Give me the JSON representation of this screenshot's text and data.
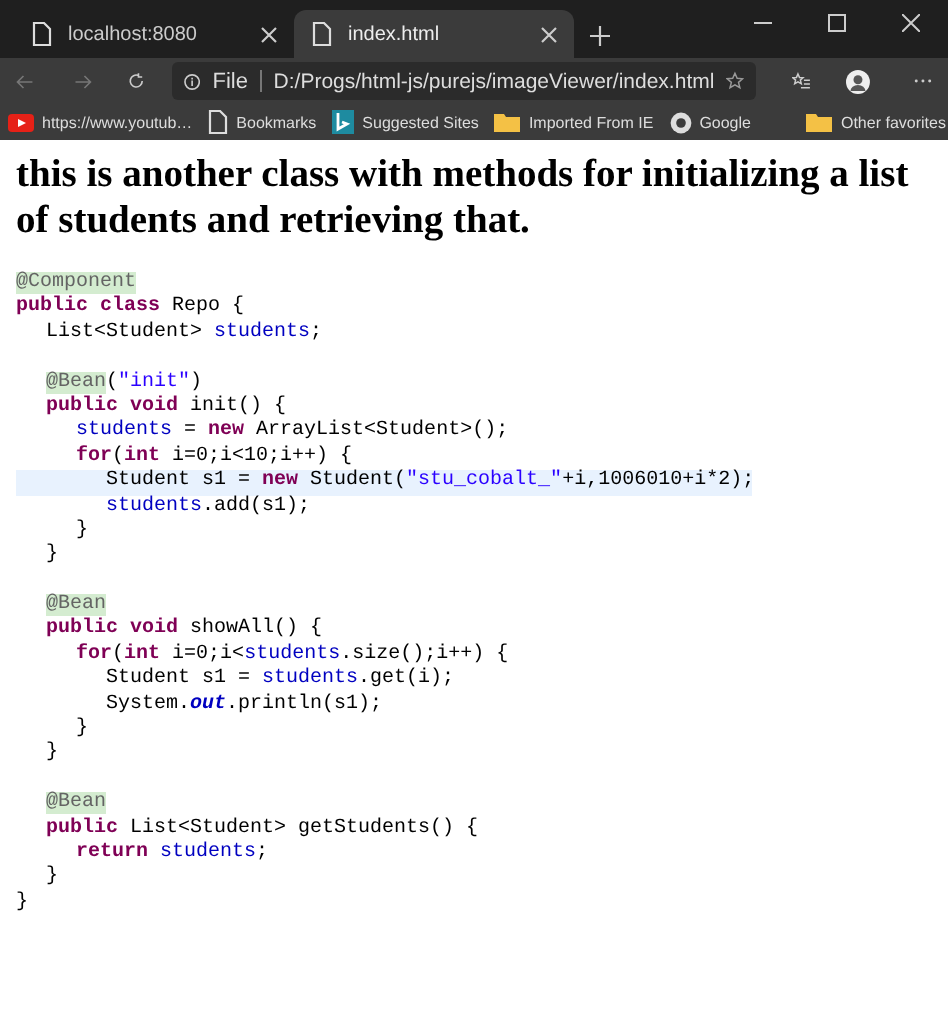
{
  "tabs": [
    {
      "title": "localhost:8080",
      "selected": false
    },
    {
      "title": "index.html",
      "selected": true
    }
  ],
  "address_bar": {
    "scheme": "File",
    "url": "D:/Progs/html-js/purejs/imageViewer/index.html"
  },
  "bookmarks": [
    {
      "label": "https://www.youtub…",
      "kind": "video"
    },
    {
      "label": "Bookmarks",
      "kind": "page"
    },
    {
      "label": "Suggested Sites",
      "kind": "search"
    },
    {
      "label": "Imported From IE",
      "kind": "folder"
    },
    {
      "label": "Google",
      "kind": "globe"
    }
  ],
  "other_bookmarks": {
    "label": "Other favorites",
    "kind": "folder"
  },
  "page": {
    "heading": "this is another class with methods for initializing a list of students and retrieving that.",
    "code": [
      {
        "kind": "code",
        "current": false,
        "segs": [
          {
            "kind": "ann",
            "t": "@Component"
          }
        ]
      },
      {
        "kind": "code",
        "current": false,
        "segs": [
          {
            "kind": "kw",
            "t": "public class"
          },
          {
            "kind": "p",
            "t": " Repo {"
          }
        ],
        "children": [
          {
            "kind": "code",
            "current": false,
            "segs": [
              {
                "kind": "p",
                "t": "List<Student> "
              },
              {
                "kind": "f",
                "t": "students"
              },
              {
                "kind": "p",
                "t": ";"
              }
            ]
          },
          {
            "kind": "blank"
          },
          {
            "kind": "code",
            "current": false,
            "segs": [
              {
                "kind": "ann",
                "t": "@Bean"
              },
              {
                "kind": "p",
                "t": "("
              },
              {
                "kind": "s",
                "t": "\"init\""
              },
              {
                "kind": "p",
                "t": ")"
              }
            ]
          },
          {
            "kind": "code",
            "current": false,
            "segs": [
              {
                "kind": "kw",
                "t": "public void"
              },
              {
                "kind": "p",
                "t": " init() {"
              }
            ],
            "children": [
              {
                "kind": "code",
                "current": false,
                "segs": [
                  {
                    "kind": "f",
                    "t": "students"
                  },
                  {
                    "kind": "p",
                    "t": " = "
                  },
                  {
                    "kind": "kw",
                    "t": "new"
                  },
                  {
                    "kind": "p",
                    "t": " ArrayList<Student>();"
                  }
                ]
              },
              {
                "kind": "code",
                "current": false,
                "segs": [
                  {
                    "kind": "kw",
                    "t": "for"
                  },
                  {
                    "kind": "p",
                    "t": "("
                  },
                  {
                    "kind": "kw",
                    "t": "int"
                  },
                  {
                    "kind": "p",
                    "t": " i=0;i<10;i++) {"
                  }
                ],
                "children": [
                  {
                    "kind": "code",
                    "current": true,
                    "segs": [
                      {
                        "kind": "p",
                        "t": "Student s1 = "
                      },
                      {
                        "kind": "kw",
                        "t": "new"
                      },
                      {
                        "kind": "p",
                        "t": " Student("
                      },
                      {
                        "kind": "s",
                        "t": "\"stu_cobalt_\""
                      },
                      {
                        "kind": "p",
                        "t": "+i,1006010+i*2);"
                      }
                    ]
                  },
                  {
                    "kind": "code",
                    "current": false,
                    "segs": [
                      {
                        "kind": "f",
                        "t": "students"
                      },
                      {
                        "kind": "p",
                        "t": ".add(s1);"
                      }
                    ]
                  }
                ]
              },
              {
                "kind": "code",
                "current": false,
                "segs": [
                  {
                    "kind": "p",
                    "t": "}"
                  }
                ]
              }
            ]
          },
          {
            "kind": "code",
            "current": false,
            "segs": [
              {
                "kind": "p",
                "t": "}"
              }
            ]
          },
          {
            "kind": "blank"
          },
          {
            "kind": "code",
            "current": false,
            "segs": [
              {
                "kind": "ann",
                "t": "@Bean"
              }
            ]
          },
          {
            "kind": "code",
            "current": false,
            "segs": [
              {
                "kind": "kw",
                "t": "public void"
              },
              {
                "kind": "p",
                "t": " showAll() {"
              }
            ],
            "children": [
              {
                "kind": "code",
                "current": false,
                "segs": [
                  {
                    "kind": "kw",
                    "t": "for"
                  },
                  {
                    "kind": "p",
                    "t": "("
                  },
                  {
                    "kind": "kw",
                    "t": "int"
                  },
                  {
                    "kind": "p",
                    "t": " i=0;i<"
                  },
                  {
                    "kind": "f",
                    "t": "students"
                  },
                  {
                    "kind": "p",
                    "t": ".size();i++) {"
                  }
                ],
                "children": [
                  {
                    "kind": "code",
                    "current": false,
                    "segs": [
                      {
                        "kind": "p",
                        "t": "Student s1 = "
                      },
                      {
                        "kind": "f",
                        "t": "students"
                      },
                      {
                        "kind": "p",
                        "t": ".get(i);"
                      }
                    ]
                  },
                  {
                    "kind": "code",
                    "current": false,
                    "segs": [
                      {
                        "kind": "p",
                        "t": "System."
                      },
                      {
                        "kind": "sf",
                        "t": "out"
                      },
                      {
                        "kind": "p",
                        "t": ".println(s1);"
                      }
                    ]
                  }
                ]
              },
              {
                "kind": "code",
                "current": false,
                "segs": [
                  {
                    "kind": "p",
                    "t": "}"
                  }
                ]
              }
            ]
          },
          {
            "kind": "code",
            "current": false,
            "segs": [
              {
                "kind": "p",
                "t": "}"
              }
            ]
          },
          {
            "kind": "blank"
          },
          {
            "kind": "code",
            "current": false,
            "segs": [
              {
                "kind": "ann",
                "t": "@Bean"
              }
            ]
          },
          {
            "kind": "code",
            "current": false,
            "segs": [
              {
                "kind": "kw",
                "t": "public"
              },
              {
                "kind": "p",
                "t": " List<Student> getStudents() {"
              }
            ],
            "children": [
              {
                "kind": "code",
                "current": false,
                "segs": [
                  {
                    "kind": "kw",
                    "t": "return"
                  },
                  {
                    "kind": "f",
                    "t": " students"
                  },
                  {
                    "kind": "p",
                    "t": ";"
                  }
                ]
              }
            ]
          },
          {
            "kind": "code",
            "current": false,
            "segs": [
              {
                "kind": "p",
                "t": "}"
              }
            ]
          }
        ]
      },
      {
        "kind": "code",
        "current": false,
        "segs": [
          {
            "kind": "p",
            "t": "}"
          }
        ]
      }
    ]
  }
}
